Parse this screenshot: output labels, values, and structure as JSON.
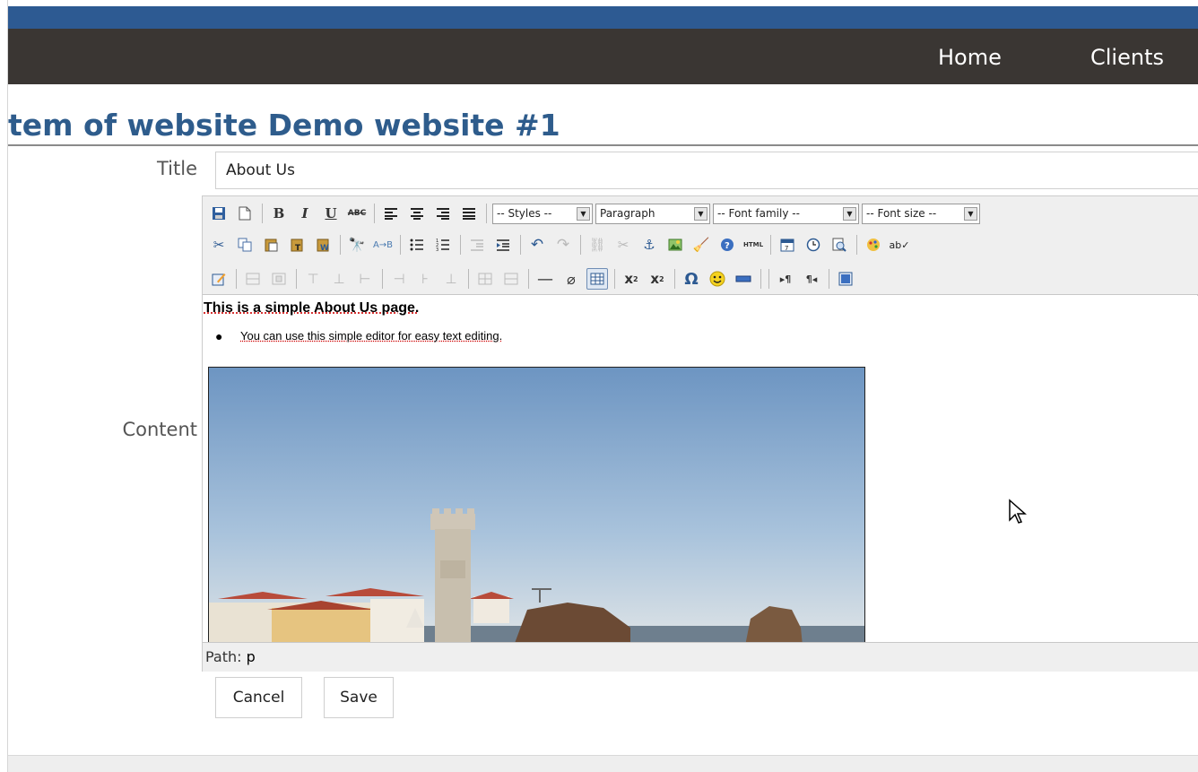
{
  "nav": {
    "home": "Home",
    "clients": "Clients"
  },
  "page": {
    "title": "tem of website Demo website #1"
  },
  "form": {
    "title_label": "Title",
    "title_value": "About Us",
    "content_label": "Content"
  },
  "toolbar": {
    "styles": "-- Styles --",
    "format": "Paragraph",
    "font_family": "-- Font family --",
    "font_size": "-- Font size --",
    "html_label": "HTML"
  },
  "content": {
    "heading": "This is a simple About Us page.",
    "bullet": "You can use this simple editor for easy text editing."
  },
  "pathbar": {
    "label": "Path:",
    "value": "p"
  },
  "buttons": {
    "cancel": "Cancel",
    "save": "Save"
  },
  "colors": {
    "topbar": "#2d5a92",
    "navbar": "#3a3633",
    "title": "#2e5c8c"
  }
}
